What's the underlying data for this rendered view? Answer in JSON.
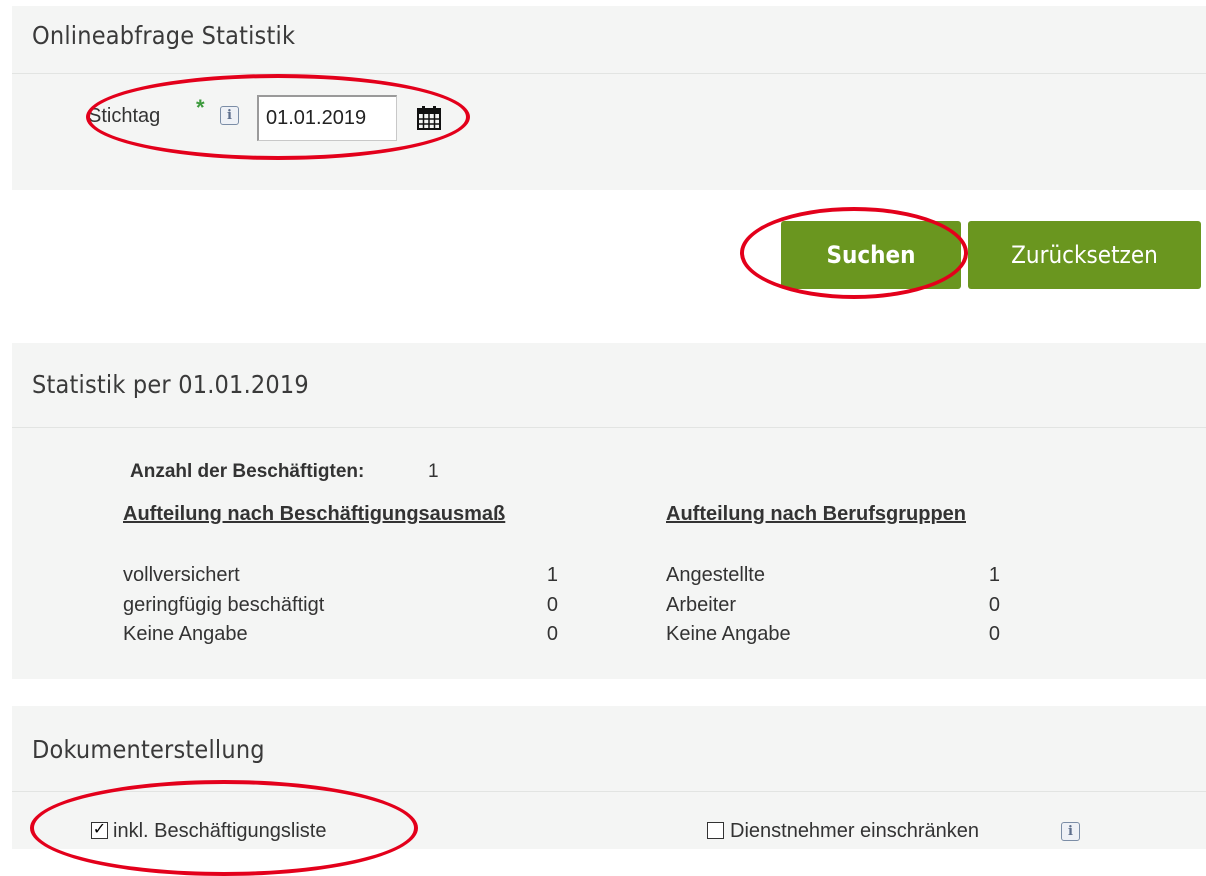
{
  "query_panel": {
    "title": "Onlineabfrage Statistik",
    "field_label": "Stichtag",
    "required_marker": "*",
    "info_glyph": "i",
    "date_value": "01.01.2019"
  },
  "actions": {
    "search_label": "Suchen",
    "reset_label": "Zurücksetzen",
    "button_color": "#6a961f"
  },
  "stats_panel": {
    "title": "Statistik per 01.01.2019",
    "count_label": "Anzahl der Beschäftigten:",
    "count_value": "1",
    "left_heading": "Aufteilung nach Beschäftigungsausmaß",
    "right_heading": "Aufteilung nach Berufsgruppen",
    "left_rows": [
      {
        "label": "vollversichert",
        "value": "1"
      },
      {
        "label": "geringfügig beschäftigt",
        "value": "0"
      },
      {
        "label": "Keine Angabe",
        "value": "0"
      }
    ],
    "right_rows": [
      {
        "label": "Angestellte",
        "value": "1"
      },
      {
        "label": "Arbeiter",
        "value": "0"
      },
      {
        "label": "Keine Angabe",
        "value": "0"
      }
    ]
  },
  "doc_panel": {
    "title": "Dokumenterstellung",
    "include_list_label": "inkl. Beschäftigungsliste",
    "include_list_checked": true,
    "check_glyph": "✓",
    "restrict_label": "Dienstnehmer einschränken",
    "restrict_checked": false,
    "info_glyph": "i"
  },
  "annotation_color": "#e3001b"
}
